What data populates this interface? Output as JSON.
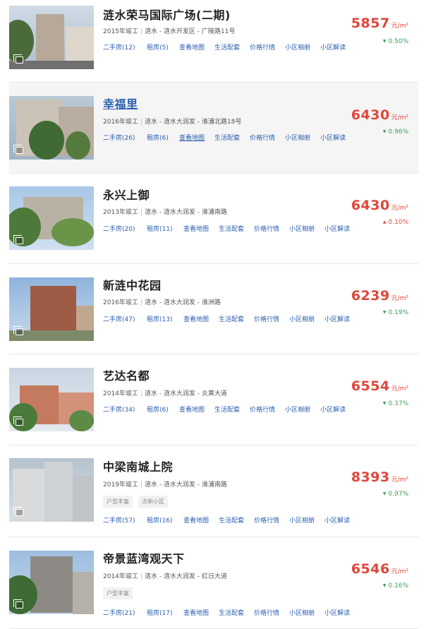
{
  "price_unit": "元/m²",
  "links": [
    "二手房",
    "租房",
    "查看地图",
    "生活配套",
    "价格行情",
    "小区相册",
    "小区解读"
  ],
  "colors": {
    "price": "#e0463b",
    "down": "#3aa05a",
    "up": "#e0463b",
    "link": "#2a5fb0"
  },
  "listings": [
    {
      "name": "涟水荣马国际广场(二期)",
      "year": "2015年竣工",
      "district": "涟水 - 涟水开发区 - 广陵路11号",
      "price": "5857",
      "change": "0.50%",
      "direction": "down",
      "ershou": "二手房(12)",
      "zufang": "租房(5)",
      "tags": []
    },
    {
      "name": "幸福里",
      "year": "2016年竣工",
      "district": "涟水 - 涟水大润发 - 淮浦北路18号",
      "price": "6430",
      "change": "0.96%",
      "direction": "down",
      "ershou": "二手房(26)",
      "zufang": "租房(6)",
      "tags": []
    },
    {
      "name": "永兴上御",
      "year": "2013年竣工",
      "district": "涟水 - 涟水大润发 - 淮浦南路",
      "price": "6430",
      "change": "0.10%",
      "direction": "up",
      "ershou": "二手房(20)",
      "zufang": "租房(11)",
      "tags": []
    },
    {
      "name": "新涟中花园",
      "year": "2016年竣工",
      "district": "涟水 - 涟水大润发 - 淮洲路",
      "price": "6239",
      "change": "0.19%",
      "direction": "down",
      "ershou": "二手房(47)",
      "zufang": "租房(13)",
      "tags": []
    },
    {
      "name": "艺达名都",
      "year": "2014年竣工",
      "district": "涟水 - 涟水大润发 - 炎黄大道",
      "price": "6554",
      "change": "0.37%",
      "direction": "down",
      "ershou": "二手房(34)",
      "zufang": "租房(6)",
      "tags": []
    },
    {
      "name": "中梁南城上院",
      "year": "2019年竣工",
      "district": "涟水 - 涟水大润发 - 淮浦南路",
      "price": "8393",
      "change": "0.97%",
      "direction": "down",
      "ershou": "二手房(57)",
      "zufang": "租房(16)",
      "tags": [
        "户型丰富",
        "次新小区"
      ]
    },
    {
      "name": "帝景蓝湾观天下",
      "year": "2014年竣工",
      "district": "涟水 - 涟水大润发 - 红日大道",
      "price": "6546",
      "change": "0.16%",
      "direction": "down",
      "ershou": "二手房(21)",
      "zufang": "租房(17)",
      "tags": [
        "户型丰富"
      ]
    }
  ]
}
